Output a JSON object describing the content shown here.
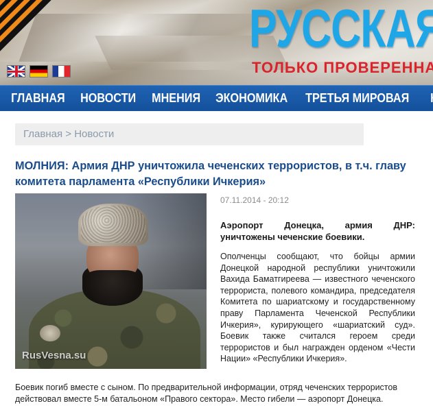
{
  "header": {
    "brand": "РУССКАЯ",
    "tagline": "ТОЛЬКО ПРОВЕРЕННА",
    "languages": [
      {
        "name": "English",
        "icon": "uk-flag-icon"
      },
      {
        "name": "Deutsch",
        "icon": "germany-flag-icon"
      },
      {
        "name": "Français",
        "icon": "france-flag-icon"
      }
    ]
  },
  "nav": {
    "items": [
      "ГЛАВНАЯ",
      "НОВОСТИ",
      "МНЕНИЯ",
      "ЭКОНОМИКА",
      "ТРЕТЬЯ МИРОВАЯ",
      "КОЛОНКА"
    ],
    "active_index": 1
  },
  "breadcrumb": {
    "home": "Главная",
    "separator": ">",
    "current": "Новости"
  },
  "article": {
    "title": "МОЛНИЯ: Армия ДНР уничтожила чеченских террористов, в т.ч. главу комитета парламента «Республики Ичкерия»",
    "date": "07.11.2014 - 20:12",
    "photo_watermark": "RusVesna.su",
    "lead": "Аэропорт Донецка, армия ДНР: уничтожены чеченские боевики.",
    "paragraph1": "Ополченцы сообщают, что бойцы армии Донецкой народной республики уничтожили Вахида Баматгиреева — известного чеченского террориста, полевого командира, председателя Комитета по шариатскому и государственному праву Парламента Чеченской Республики Ичкерия», курирующего «шариатский суд». Боевик также считался героем среди террористов и был награжден орденом «Чести Нации» «Республики Ичкерия».",
    "paragraph2": "Боевик погиб вместе с сыном. По предварительной информации, отряд чеченских террористов действовал вместе 5-м батальоном «Правого сектора». Место гибели — аэропорт Донецка."
  },
  "colors": {
    "brand": "#1ea6e6",
    "tagline": "#d9242b",
    "nav_bg": "#1a5aa8",
    "headline": "#1a4c8c"
  }
}
